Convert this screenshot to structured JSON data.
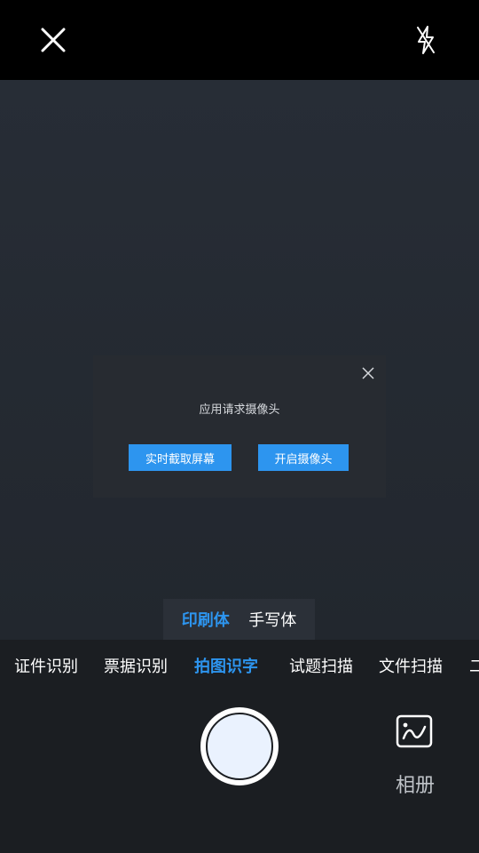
{
  "top_bar": {
    "close_icon": "close-icon",
    "flash_icon": "flash-off-icon"
  },
  "dialog": {
    "title": "应用请求摄像头",
    "capture_screen_label": "实时截取屏幕",
    "open_camera_label": "开启摄像头",
    "close_icon": "close-icon"
  },
  "mode_toggle": {
    "options": [
      "印刷体",
      "手写体"
    ],
    "selected": "印刷体"
  },
  "tabs": {
    "items": [
      "证件识别",
      "票据识别",
      "拍图识字",
      "试题扫描",
      "文件扫描",
      "二"
    ],
    "selected": "拍图识字"
  },
  "bottom": {
    "album_label": "相册",
    "album_icon": "image-icon",
    "shutter_icon": "shutter-button"
  },
  "colors": {
    "accent": "#2d95ef",
    "top_bar": "#000000",
    "viewfinder": "#252a32",
    "panel": "#1b1e22"
  }
}
